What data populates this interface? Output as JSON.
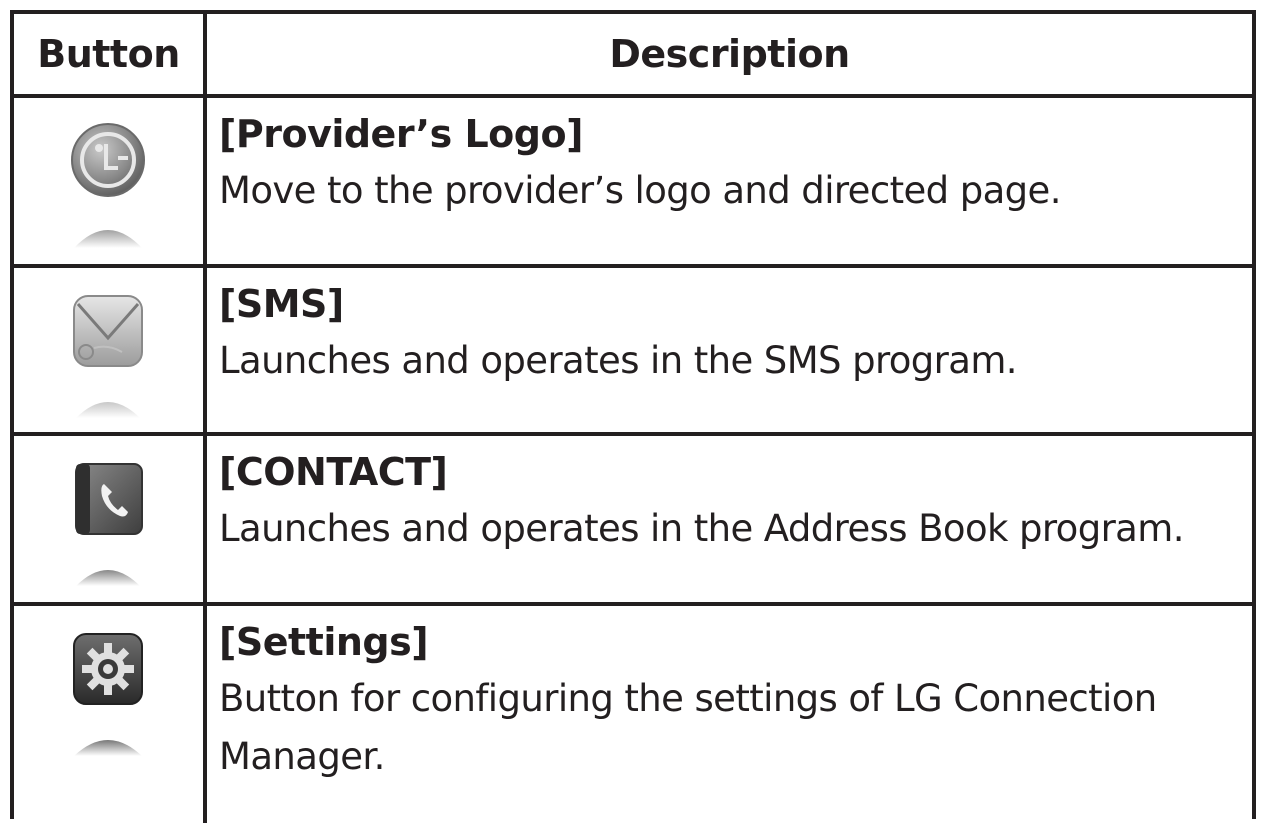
{
  "table": {
    "headers": {
      "button": "Button",
      "description": "Description"
    },
    "rows": [
      {
        "icon": "lg-logo-icon",
        "title": "[Provider’s Logo]",
        "description": "Move to the provider’s logo and directed page."
      },
      {
        "icon": "envelope-icon",
        "title": "[SMS]",
        "description": "Launches and operates in the SMS program."
      },
      {
        "icon": "phone-book-icon",
        "title": "[CONTACT]",
        "description": "Launches and operates in the Address Book program."
      },
      {
        "icon": "gear-icon",
        "title": "[Settings]",
        "description_line1": "Button for configuring the settings of LG Connection",
        "description_line2": "Manager."
      }
    ]
  },
  "colors": {
    "rule": "#231f20",
    "text": "#231f20"
  }
}
